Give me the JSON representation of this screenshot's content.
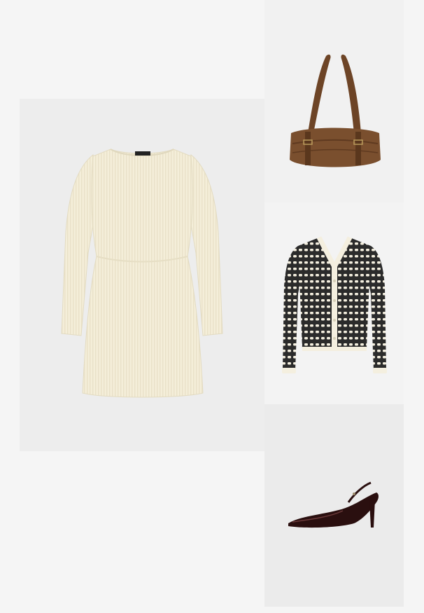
{
  "board": {
    "background_color": "#f5f5f5",
    "items": [
      {
        "id": "dress",
        "kind": "knit-mini-dress",
        "color": "#f3ecd6"
      },
      {
        "id": "bag",
        "kind": "leather-shoulder-bag",
        "color": "#7a4f2e"
      },
      {
        "id": "cardigan",
        "kind": "striped-cardigan",
        "color": "#2b2b2b",
        "trim_color": "#f4efdf"
      },
      {
        "id": "shoe",
        "kind": "slingback-pump",
        "color": "#2a0f0f"
      }
    ]
  }
}
